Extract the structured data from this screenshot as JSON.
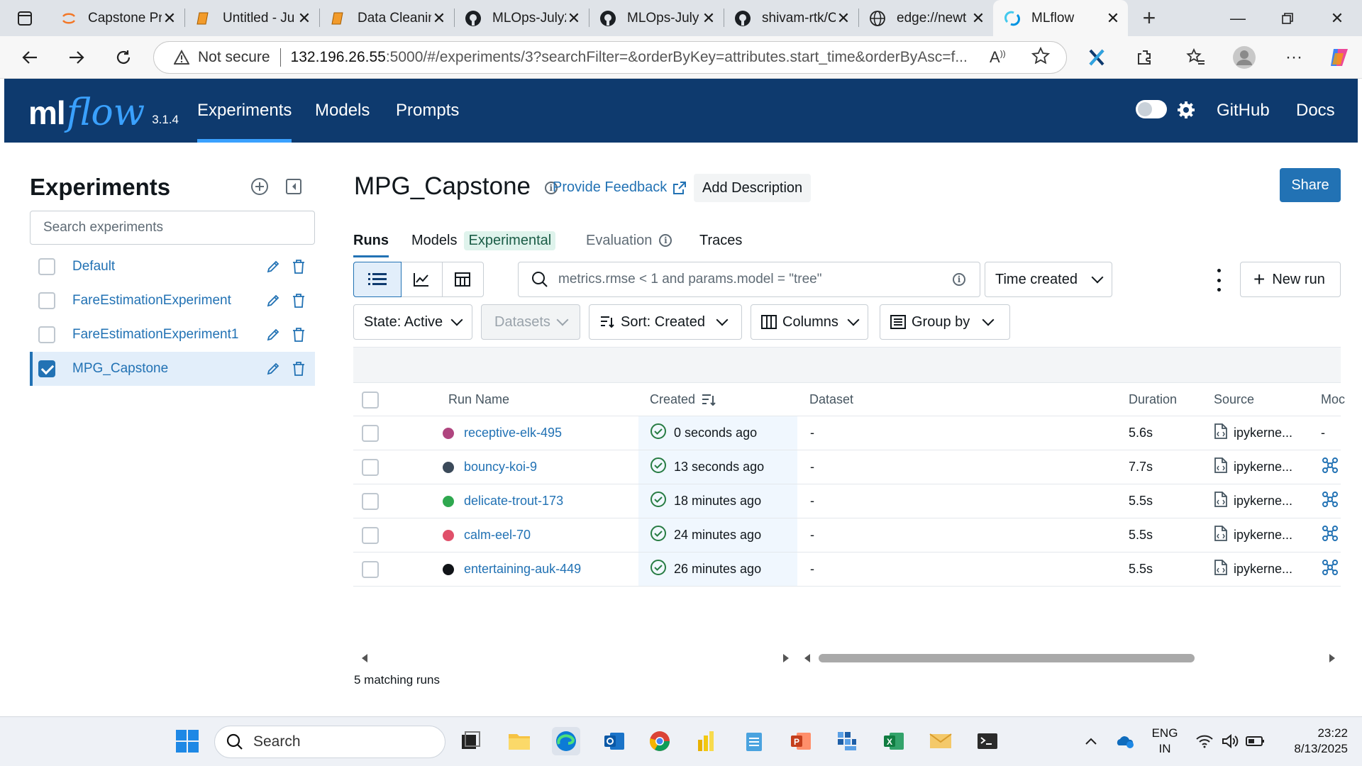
{
  "browser": {
    "tabs": [
      {
        "title": "Capstone Pr",
        "icon": "jupyter-icon"
      },
      {
        "title": "Untitled - Ju",
        "icon": "jupyter-notebook-icon"
      },
      {
        "title": "Data Cleanin",
        "icon": "jupyter-notebook-icon"
      },
      {
        "title": "MLOps-July2",
        "icon": "github-icon"
      },
      {
        "title": "MLOps-July",
        "icon": "github-icon"
      },
      {
        "title": "shivam-rtk/C",
        "icon": "github-icon"
      },
      {
        "title": "edge://newt",
        "icon": "globe-icon"
      },
      {
        "title": "MLflow",
        "icon": "mlflow-icon"
      }
    ],
    "address": {
      "security": "Not secure",
      "host": "132.196.26.55",
      "rest": ":5000/#/experiments/3?searchFilter=&orderByKey=attributes.start_time&orderByAsc=f..."
    }
  },
  "header": {
    "logo_ml": "ml",
    "logo_flow": "flow",
    "version": "3.1.4",
    "nav": [
      "Experiments",
      "Models",
      "Prompts"
    ],
    "links": [
      "GitHub",
      "Docs"
    ]
  },
  "sidebar": {
    "title": "Experiments",
    "search_placeholder": "Search experiments",
    "experiments": [
      {
        "name": "Default",
        "selected": false
      },
      {
        "name": "FareEstimationExperiment",
        "selected": false
      },
      {
        "name": "FareEstimationExperiment1",
        "selected": false
      },
      {
        "name": "MPG_Capstone",
        "selected": true
      }
    ]
  },
  "main": {
    "title": "MPG_Capstone",
    "feedback": "Provide Feedback",
    "add_description": "Add Description",
    "share": "Share",
    "tabs": {
      "runs": "Runs",
      "models": "Models",
      "experimental": "Experimental",
      "evaluation": "Evaluation",
      "traces": "Traces"
    },
    "filter_placeholder": "metrics.rmse < 1 and params.model = \"tree\"",
    "time_created": "Time created",
    "new_run": "New run",
    "state": "State: Active",
    "datasets": "Datasets",
    "sort": "Sort: Created",
    "columns": "Columns",
    "group_by": "Group by",
    "table": {
      "headers": {
        "run_name": "Run Name",
        "created": "Created",
        "dataset": "Dataset",
        "duration": "Duration",
        "source": "Source",
        "models": "Moc"
      },
      "rows": [
        {
          "name": "receptive-elk-495",
          "color": "#b0457f",
          "created": "0 seconds ago",
          "dataset": "-",
          "duration": "5.6s",
          "source": "ipykerne...",
          "model": "-"
        },
        {
          "name": "bouncy-koi-9",
          "color": "#3b4a5a",
          "created": "13 seconds ago",
          "dataset": "-",
          "duration": "7.7s",
          "source": "ipykerne...",
          "model": "model-icon"
        },
        {
          "name": "delicate-trout-173",
          "color": "#2fa84f",
          "created": "18 minutes ago",
          "dataset": "-",
          "duration": "5.5s",
          "source": "ipykerne...",
          "model": "model-icon"
        },
        {
          "name": "calm-eel-70",
          "color": "#e0506a",
          "created": "24 minutes ago",
          "dataset": "-",
          "duration": "5.5s",
          "source": "ipykerne...",
          "model": "model-icon"
        },
        {
          "name": "entertaining-auk-449",
          "color": "#111418",
          "created": "26 minutes ago",
          "dataset": "-",
          "duration": "5.5s",
          "source": "ipykerne...",
          "model": "model-icon"
        }
      ]
    },
    "matching": "5 matching runs"
  },
  "taskbar": {
    "search": "Search",
    "lang": "ENG",
    "region": "IN",
    "time": "23:22",
    "date": "8/13/2025"
  }
}
